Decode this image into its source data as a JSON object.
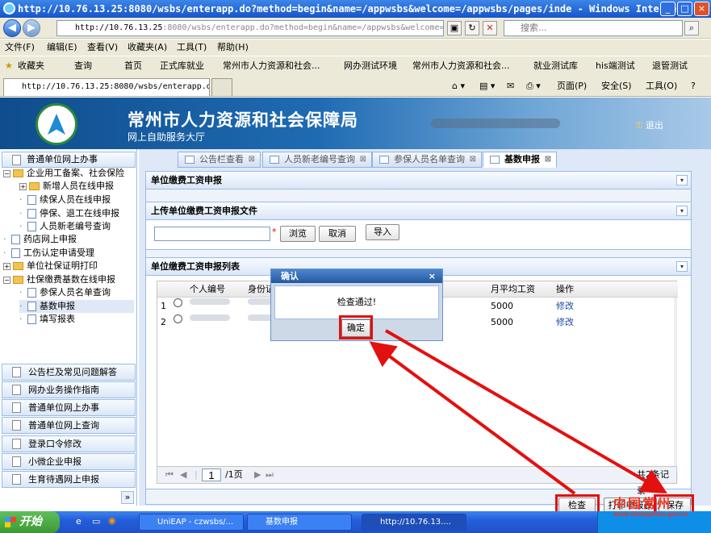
{
  "window": {
    "title": "http://10.76.13.25:8080/wsbs/enterapp.do?method=begin&name=/appwsbs&welcome=/appwsbs/pages/inde - Windows Interne..."
  },
  "browser": {
    "address_host": "http://10.76.13.25",
    "address_rest": ":8080/wsbs/enterapp.do?method=begin&name=/appwsbs&welcome=/appwsbs/",
    "search_placeholder": "搜索...",
    "menu": [
      "文件(F)",
      "编辑(E)",
      "查看(V)",
      "收藏夹(A)",
      "工具(T)",
      "帮助(H)"
    ],
    "favorites_label": "收藏夹",
    "favorites": [
      "查询",
      "首页",
      "正式库就业",
      "常州市人力资源和社会...",
      "网办测试环境",
      "常州市人力资源和社会...",
      "就业测试库",
      "his端测试",
      "退管测试"
    ],
    "tab_title": "http://10.76.13.25:8080/wsbs/enterapp.do?...",
    "toolbar": {
      "page": "页面(P)",
      "safety": "安全(S)",
      "tools": "工具(O)",
      "help": "?"
    }
  },
  "banner": {
    "title": "常州市人力资源和社会保障局",
    "subtitle": "网上自助服务大厅",
    "logout": "退出"
  },
  "sidebar": {
    "top_header": "普通单位网上办事",
    "tree": [
      {
        "label": "企业用工备案、社会保险",
        "level": 0,
        "type": "folder",
        "expander": "−"
      },
      {
        "label": "新增人员在线申报",
        "level": 1,
        "type": "folder",
        "expander": "+"
      },
      {
        "label": "续保人员在线申报",
        "level": 1,
        "type": "leaf"
      },
      {
        "label": "停保、退工在线申报",
        "level": 1,
        "type": "leaf"
      },
      {
        "label": "人员新老编号查询",
        "level": 1,
        "type": "leaf"
      },
      {
        "label": "药店网上申报",
        "level": 0,
        "type": "leaf"
      },
      {
        "label": "工伤认定申请受理",
        "level": 0,
        "type": "leaf"
      },
      {
        "label": "单位社保证明打印",
        "level": 0,
        "type": "folder",
        "expander": "+"
      },
      {
        "label": "社保缴费基数在线申报",
        "level": 0,
        "type": "folder",
        "expander": "−"
      },
      {
        "label": "参保人员名单查询",
        "level": 1,
        "type": "leaf"
      },
      {
        "label": "基数申报",
        "level": 1,
        "type": "leaf",
        "selected": true
      },
      {
        "label": "填写报表",
        "level": 1,
        "type": "leaf"
      }
    ],
    "accordion": [
      "公告栏及常见问题解答",
      "网办业务操作指南",
      "普通单位网上办事",
      "普通单位网上查询",
      "登录口令修改",
      "小微企业申报",
      "生育待遇网上申报"
    ],
    "more": "»"
  },
  "tabs": [
    {
      "label": "公告栏查看",
      "active": false
    },
    {
      "label": "人员新老编号查询",
      "active": false
    },
    {
      "label": "参保人员名单查询",
      "active": false
    },
    {
      "label": "基数申报",
      "active": true
    }
  ],
  "page_title": "单位缴费工资申报",
  "upload": {
    "title": "上传单位缴费工资申报文件",
    "required_mark": "*",
    "browse": "浏览",
    "cancel": "取消",
    "import": "导入"
  },
  "list": {
    "title": "单位缴费工资申报列表",
    "columns": [
      "个人编号",
      "身份证",
      "月平均工资",
      "操作"
    ],
    "rows": [
      {
        "index": "1",
        "salary": "5000",
        "action": "修改"
      },
      {
        "index": "2",
        "salary": "5000",
        "action": "修改"
      }
    ],
    "pager": {
      "page_value": "1",
      "total_pages": "/1页",
      "summary": "共2条记录"
    }
  },
  "dialog": {
    "title": "确认",
    "close": "×",
    "message": "检查通过!",
    "ok": "确定"
  },
  "footer_buttons": {
    "check": "检查",
    "print": "打印申报表",
    "save": "保存"
  },
  "taskbar": {
    "start": "开始",
    "tasks": [
      "UniEAP - czwsbs/...",
      "基数申报",
      "http://10.76.13...."
    ]
  },
  "watermark": {
    "text": "中国常州",
    "url": "www.changzhou.gov.cn"
  },
  "colors": {
    "accent_red": "#e31010",
    "banner_blue": "#1f6bb3",
    "panel_border": "#99bbe8"
  }
}
